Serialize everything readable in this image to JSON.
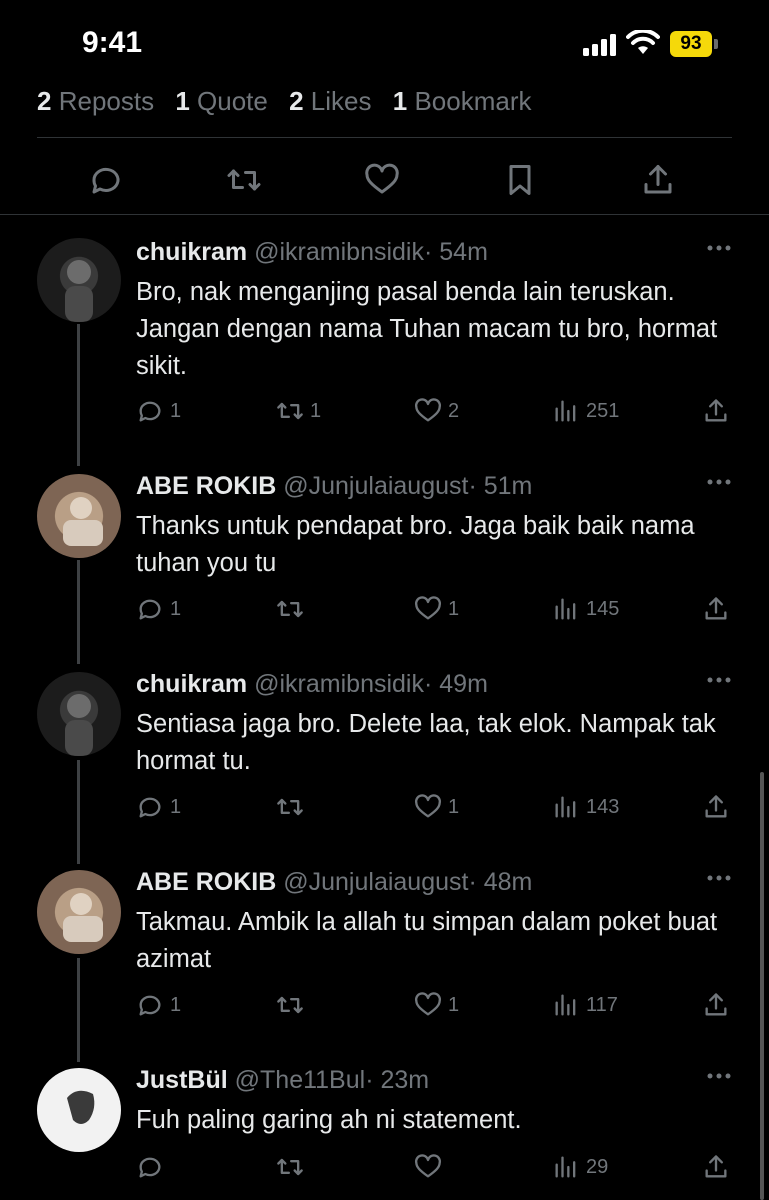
{
  "status_bar": {
    "time": "9:41",
    "battery": "93"
  },
  "stats": {
    "reposts_count": "2",
    "reposts_label": "Reposts",
    "quotes_count": "1",
    "quotes_label": "Quote",
    "likes_count": "2",
    "likes_label": "Likes",
    "bookmarks_count": "1",
    "bookmarks_label": "Bookmark"
  },
  "replies": [
    {
      "name": "chuikram",
      "handle": "@ikramibnsidik",
      "time": "· 54m",
      "text": "Bro, nak menganjing pasal benda lain teruskan. Jangan dengan nama Tuhan macam tu bro, hormat sikit.",
      "replies": "1",
      "reposts": "1",
      "likes": "2",
      "views": "251"
    },
    {
      "name": "ABE ROKIB",
      "handle": "@Junjulaiaugust",
      "time": "· 51m",
      "text": "Thanks untuk pendapat bro. Jaga baik baik nama tuhan you tu",
      "replies": "1",
      "reposts": "",
      "likes": "1",
      "views": "145"
    },
    {
      "name": "chuikram",
      "handle": "@ikramibnsidik",
      "time": "· 49m",
      "text": "Sentiasa jaga bro. Delete laa, tak elok. Nampak tak hormat tu.",
      "replies": "1",
      "reposts": "",
      "likes": "1",
      "views": "143"
    },
    {
      "name": "ABE ROKIB",
      "handle": "@Junjulaiaugust",
      "time": "· 48m",
      "text": "Takmau. Ambik la allah tu simpan dalam poket buat azimat",
      "replies": "1",
      "reposts": "",
      "likes": "1",
      "views": "117"
    },
    {
      "name": "JustBül",
      "handle": "@The11Bul",
      "time": "· 23m",
      "text": "Fuh paling garing ah ni statement.",
      "replies": "",
      "reposts": "",
      "likes": "",
      "views": "29"
    }
  ],
  "icons": {
    "reply": "reply-icon",
    "repost": "repost-icon",
    "like": "heart-icon",
    "bookmark": "bookmark-icon",
    "share": "share-icon",
    "views": "views-icon",
    "more": "more-icon"
  },
  "colors": {
    "background": "#000000",
    "text": "#e7e9ea",
    "muted": "#71767b",
    "battery": "#f5d90a"
  }
}
